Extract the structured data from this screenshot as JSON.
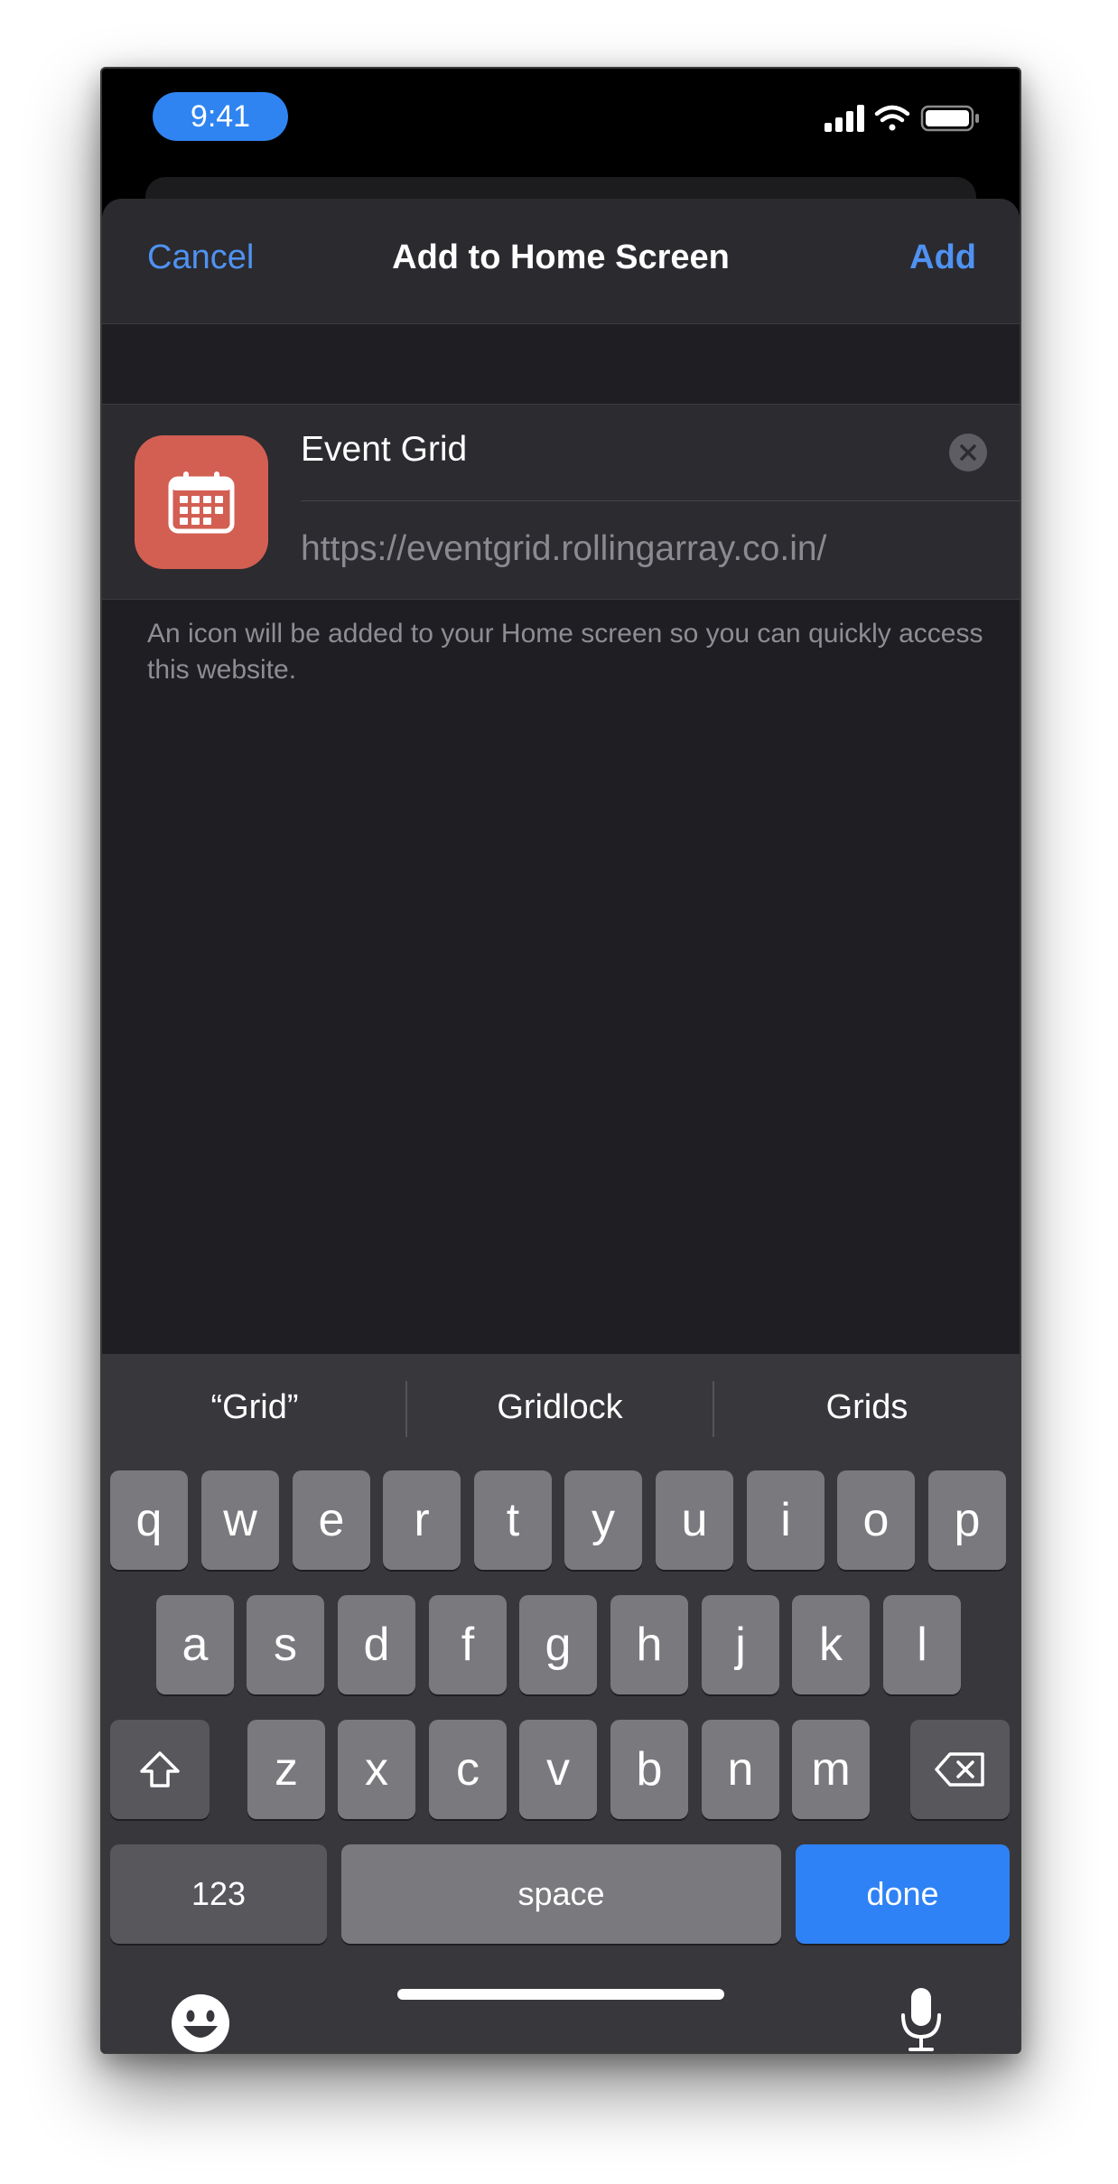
{
  "status_bar": {
    "time": "9:41"
  },
  "sheet": {
    "cancel_label": "Cancel",
    "title": "Add to Home Screen",
    "add_label": "Add",
    "app_name": "Event Grid",
    "url": "https://eventgrid.rollingarray.co.in/",
    "footnote": "An icon will be added to your Home screen so you can quickly access this website.",
    "app_icon": "calendar-icon",
    "icon_color": "#d25f52"
  },
  "keyboard": {
    "suggestions": [
      "“Grid”",
      "Gridlock",
      "Grids"
    ],
    "row1": [
      "q",
      "w",
      "e",
      "r",
      "t",
      "y",
      "u",
      "i",
      "o",
      "p"
    ],
    "row2": [
      "a",
      "s",
      "d",
      "f",
      "g",
      "h",
      "j",
      "k",
      "l"
    ],
    "row3": [
      "z",
      "x",
      "c",
      "v",
      "b",
      "n",
      "m"
    ],
    "numbers_label": "123",
    "space_label": "space",
    "done_label": "done",
    "accent": "#2e82f5"
  },
  "colors": {
    "link_blue": "#4f92f2",
    "sheet_bg": "#1f1e23",
    "key_bg": "#7a797e"
  }
}
